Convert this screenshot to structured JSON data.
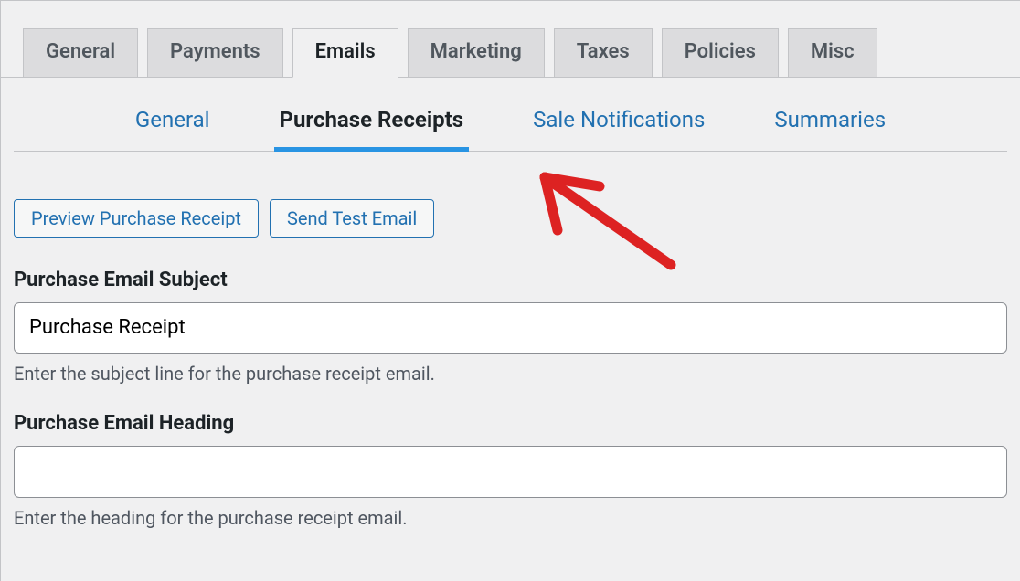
{
  "tabs": [
    {
      "label": "General"
    },
    {
      "label": "Payments"
    },
    {
      "label": "Emails"
    },
    {
      "label": "Marketing"
    },
    {
      "label": "Taxes"
    },
    {
      "label": "Policies"
    },
    {
      "label": "Misc"
    }
  ],
  "active_tab": "Emails",
  "subtabs": [
    {
      "label": "General"
    },
    {
      "label": "Purchase Receipts"
    },
    {
      "label": "Sale Notifications"
    },
    {
      "label": "Summaries"
    }
  ],
  "active_subtab": "Purchase Receipts",
  "buttons": {
    "preview": "Preview Purchase Receipt",
    "test": "Send Test Email"
  },
  "fields": {
    "subject": {
      "label": "Purchase Email Subject",
      "value": "Purchase Receipt",
      "help": "Enter the subject line for the purchase receipt email."
    },
    "heading": {
      "label": "Purchase Email Heading",
      "value": "",
      "help": "Enter the heading for the purchase receipt email."
    }
  }
}
